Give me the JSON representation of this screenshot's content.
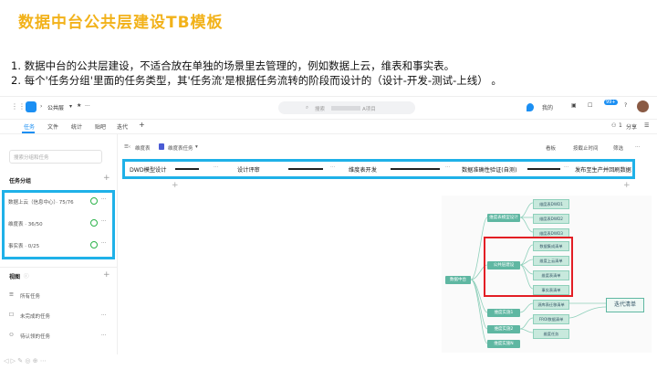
{
  "slide": {
    "title": "数据中台公共层建设TB模板",
    "bullets": [
      "1.  数据中台的公共层建设，不适合放在单独的场景里去管理的，例如数据上云，维表和事实表。",
      "2.  每个'任务分组'里面的任务类型，其'任务流'是根据任务流转的阶段而设计的（设计-开发-测试-上线）  。"
    ]
  },
  "app": {
    "project": "公共层",
    "search_placeholder": "搜索",
    "search_suffix": "A项目",
    "my_label": "我的",
    "badge": "99+",
    "tabs": [
      "任务",
      "文件",
      "统计",
      "贴吧",
      "迭代"
    ],
    "member_count": "1",
    "share": "分享",
    "sidebar": {
      "search_placeholder": "搜索分组和任务",
      "group_header": "任务分组",
      "groups": [
        {
          "label": "数据上云（信息中心）· 75/76"
        },
        {
          "label": "维度表 · 36/50"
        },
        {
          "label": "事实表 · 0/25"
        }
      ],
      "view_header": "视图",
      "views": [
        "所有任务",
        "未完成的任务",
        "待认领的任务"
      ]
    },
    "toolbar": {
      "view_left": "维度表",
      "view_task": "维度表任务",
      "board": "看板",
      "sort": "按截止时间",
      "filter": "筛选"
    },
    "flow_stages": [
      "DWD模型设计",
      "设计评审",
      "维度表开发",
      "数据准确性验证(自测)",
      "发布至生产并回刷数据"
    ],
    "mindmap": {
      "root": "数据中台",
      "branches": [
        "维度表模型设计",
        "公共层建设",
        "维度实施1",
        "维度实施2",
        "维度实施N"
      ],
      "leaves_top": [
        "维度表DWD1",
        "维度表DWD2",
        "维度表DWD3"
      ],
      "leaves_mid": [
        "数据集成清单",
        "维度上云清单",
        "维度表清单",
        "事实表清单"
      ],
      "leaves_low": [
        "源库表迁移清单",
        "FROI数据清单",
        "维度任务"
      ],
      "iteration": "迭代清单"
    }
  }
}
